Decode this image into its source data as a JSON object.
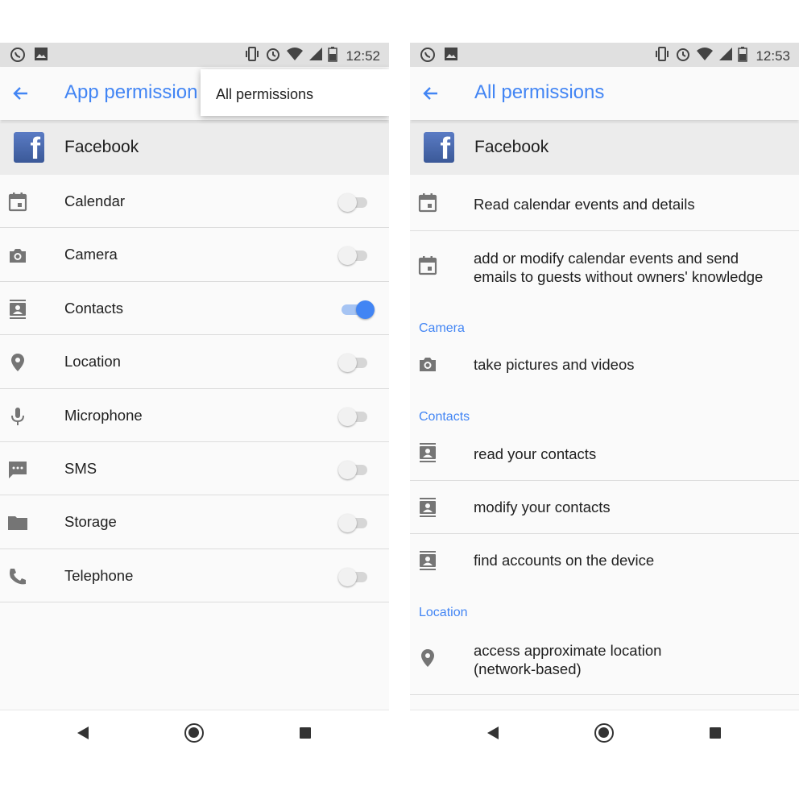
{
  "left": {
    "status_time": "12:52",
    "title": "App permission",
    "menu_item": "All permissions",
    "app_name": "Facebook",
    "permissions": [
      {
        "label": "Calendar",
        "icon": "calendar-icon",
        "enabled": false
      },
      {
        "label": "Camera",
        "icon": "camera-icon",
        "enabled": false
      },
      {
        "label": "Contacts",
        "icon": "contacts-icon",
        "enabled": true
      },
      {
        "label": "Location",
        "icon": "location-pin-icon",
        "enabled": false
      },
      {
        "label": "Microphone",
        "icon": "microphone-icon",
        "enabled": false
      },
      {
        "label": "SMS",
        "icon": "sms-icon",
        "enabled": false
      },
      {
        "label": "Storage",
        "icon": "folder-icon",
        "enabled": false
      },
      {
        "label": "Telephone",
        "icon": "phone-icon",
        "enabled": false
      }
    ]
  },
  "right": {
    "status_time": "12:53",
    "title": "All permissions",
    "app_name": "Facebook",
    "calendar_items": [
      {
        "label": "Read calendar events and details"
      },
      {
        "label_line1": "add or modify calendar events and send",
        "label_line2": "emails to guests without owners' knowledge"
      }
    ],
    "camera_header": "Camera",
    "camera_items": [
      {
        "label": "take pictures and videos"
      }
    ],
    "contacts_header": "Contacts",
    "contacts_items": [
      {
        "label": "read your contacts"
      },
      {
        "label": "modify your contacts"
      },
      {
        "label": "find accounts on the device"
      }
    ],
    "location_header": "Location",
    "location_items": [
      {
        "label_line1": "access approximate location",
        "label_line2": "(network-based)"
      }
    ]
  },
  "colors": {
    "accent": "#4285f4",
    "facebook": "#3b5998",
    "icon_gray": "#757575"
  }
}
